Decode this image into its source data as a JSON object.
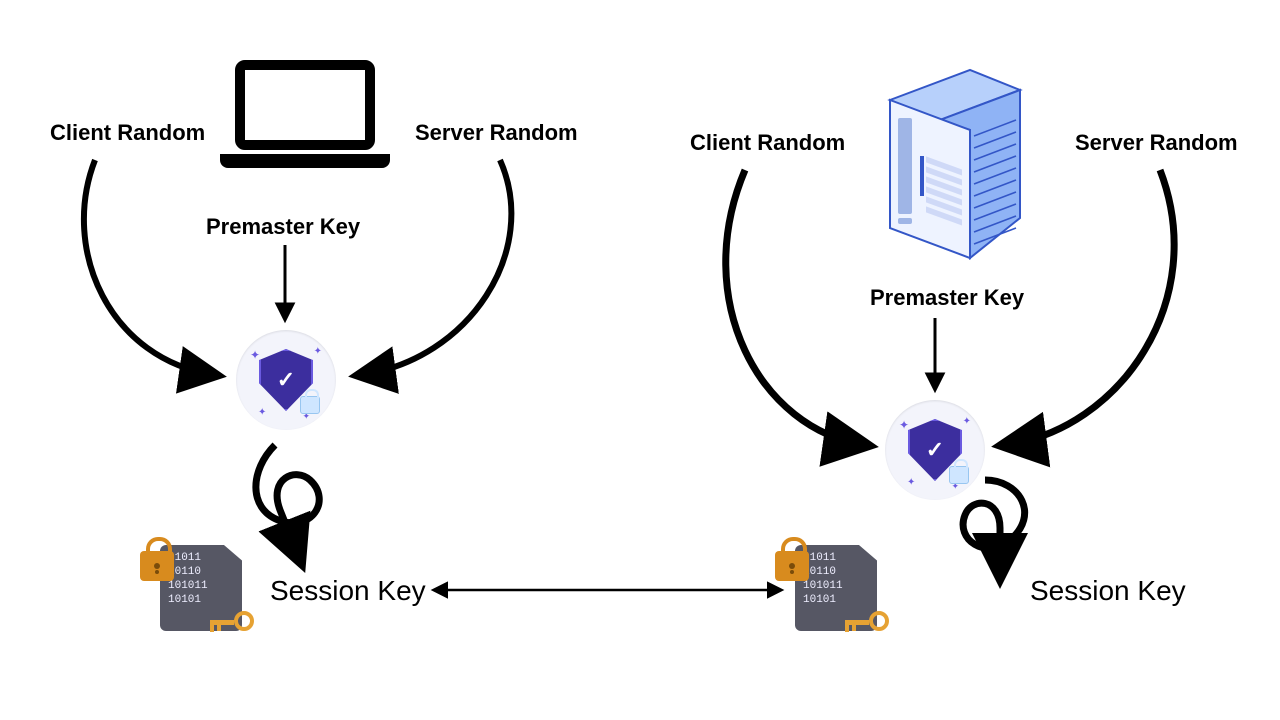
{
  "left": {
    "client_random": "Client Random",
    "server_random": "Server Random",
    "premaster": "Premaster Key",
    "session_key": "Session Key",
    "binary_lines": [
      "01011",
      "10110",
      "101011",
      "10101"
    ]
  },
  "right": {
    "client_random": "Client Random",
    "server_random": "Server Random",
    "premaster": "Premaster Key",
    "session_key": "Session Key",
    "binary_lines": [
      "01011",
      "10110",
      "101011",
      "10101"
    ]
  },
  "colors": {
    "ink": "#000000",
    "shield": "#3c2e9e",
    "shield_border": "#6a5ae0",
    "badge_bg": "#f3f4fb",
    "lock": "#d88b1e",
    "key": "#e6a233",
    "datacard": "#565764",
    "server_body": "#b7d0fb",
    "server_edge": "#3356c7",
    "server_panel": "#eef3ff"
  }
}
